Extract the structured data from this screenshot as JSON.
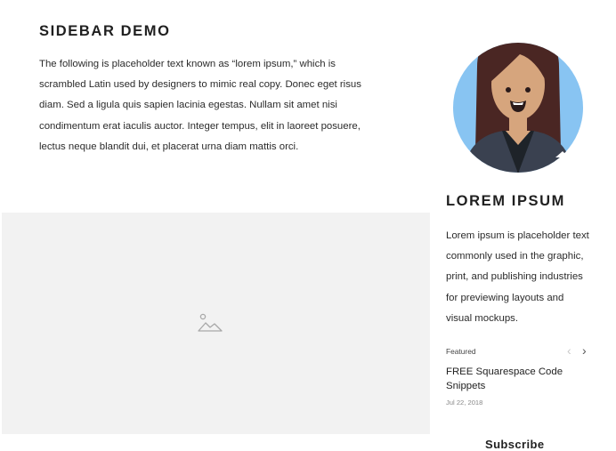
{
  "main": {
    "title": "SIDEBAR DEMO",
    "intro_lines": [
      "The following is placeholder text known as “lorem ipsum,” which is",
      "scrambled Latin used by designers to mimic real copy. Donec eget risus",
      "diam. Sed a ligula quis sapien lacinia egestas. Nullam sit amet nisi",
      "condimentum erat iaculis auctor. Integer tempus, elit in laoreet posuere,",
      "lectus neque blandit dui, et placerat urna diam mattis orci."
    ],
    "image_icon": "image-placeholder-icon"
  },
  "sidebar": {
    "avatar_icon": "person-avatar",
    "title": "LOREM IPSUM",
    "text_lines": [
      "Lorem ipsum is placeholder text",
      "commonly used in the graphic,",
      "print, and publishing industries",
      "for previewing layouts and",
      "visual mockups."
    ],
    "featured": {
      "label": "Featured",
      "prev_icon": "‹",
      "next_icon": "›",
      "title_lines": [
        "FREE Squarespace Code",
        "Snippets"
      ],
      "date": "Jul 22, 2018"
    },
    "footer_heading": "Subscribe"
  },
  "colors": {
    "avatar_bg": "#88c4f2",
    "placeholder_bg": "#f2f2f2",
    "hair": "#4a2623",
    "skin": "#d6a57d",
    "jacket": "#3a4150"
  }
}
